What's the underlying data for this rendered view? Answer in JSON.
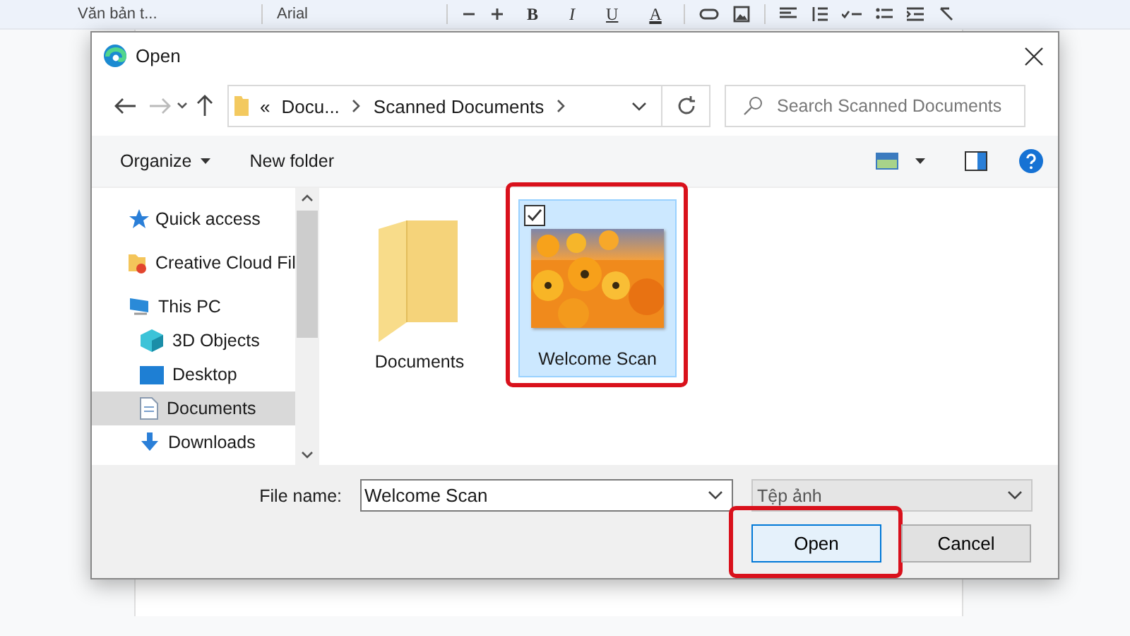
{
  "app_toolbar": {
    "style_select": "Văn bản t...",
    "font_select": "Arial",
    "format_buttons": [
      "B",
      "I",
      "U",
      "A"
    ]
  },
  "dialog": {
    "title": "Open",
    "nav": {
      "overflow": "«",
      "path": [
        {
          "label": "Docu..."
        },
        {
          "label": "Scanned Documents"
        }
      ],
      "search_placeholder": "Search Scanned Documents"
    },
    "commands": {
      "organize": "Organize",
      "new_folder": "New folder"
    },
    "sidebar": {
      "items": [
        {
          "label": "Quick access",
          "kind": "star",
          "selected": false
        },
        {
          "label": "Creative Cloud Fil",
          "kind": "cloud-folder",
          "selected": false
        },
        {
          "label": "This PC",
          "kind": "computer",
          "selected": false,
          "children": [
            {
              "label": "3D Objects",
              "kind": "cube",
              "selected": false
            },
            {
              "label": "Desktop",
              "kind": "desktop",
              "selected": false
            },
            {
              "label": "Documents",
              "kind": "document",
              "selected": true
            },
            {
              "label": "Downloads",
              "kind": "download",
              "selected": false
            }
          ]
        }
      ]
    },
    "files": [
      {
        "name": "Documents",
        "kind": "folder",
        "selected": false,
        "checked": false,
        "highlighted": false
      },
      {
        "name": "Welcome Scan",
        "kind": "picture",
        "selected": true,
        "checked": true,
        "highlighted": true
      }
    ],
    "file_name": {
      "label": "File name:",
      "value": "Welcome Scan"
    },
    "file_type": {
      "value": "Tệp ảnh"
    },
    "buttons": [
      {
        "label": "Open",
        "kind": "primary",
        "highlighted": true
      },
      {
        "label": "Cancel",
        "kind": "secondary",
        "highlighted": false
      }
    ]
  }
}
